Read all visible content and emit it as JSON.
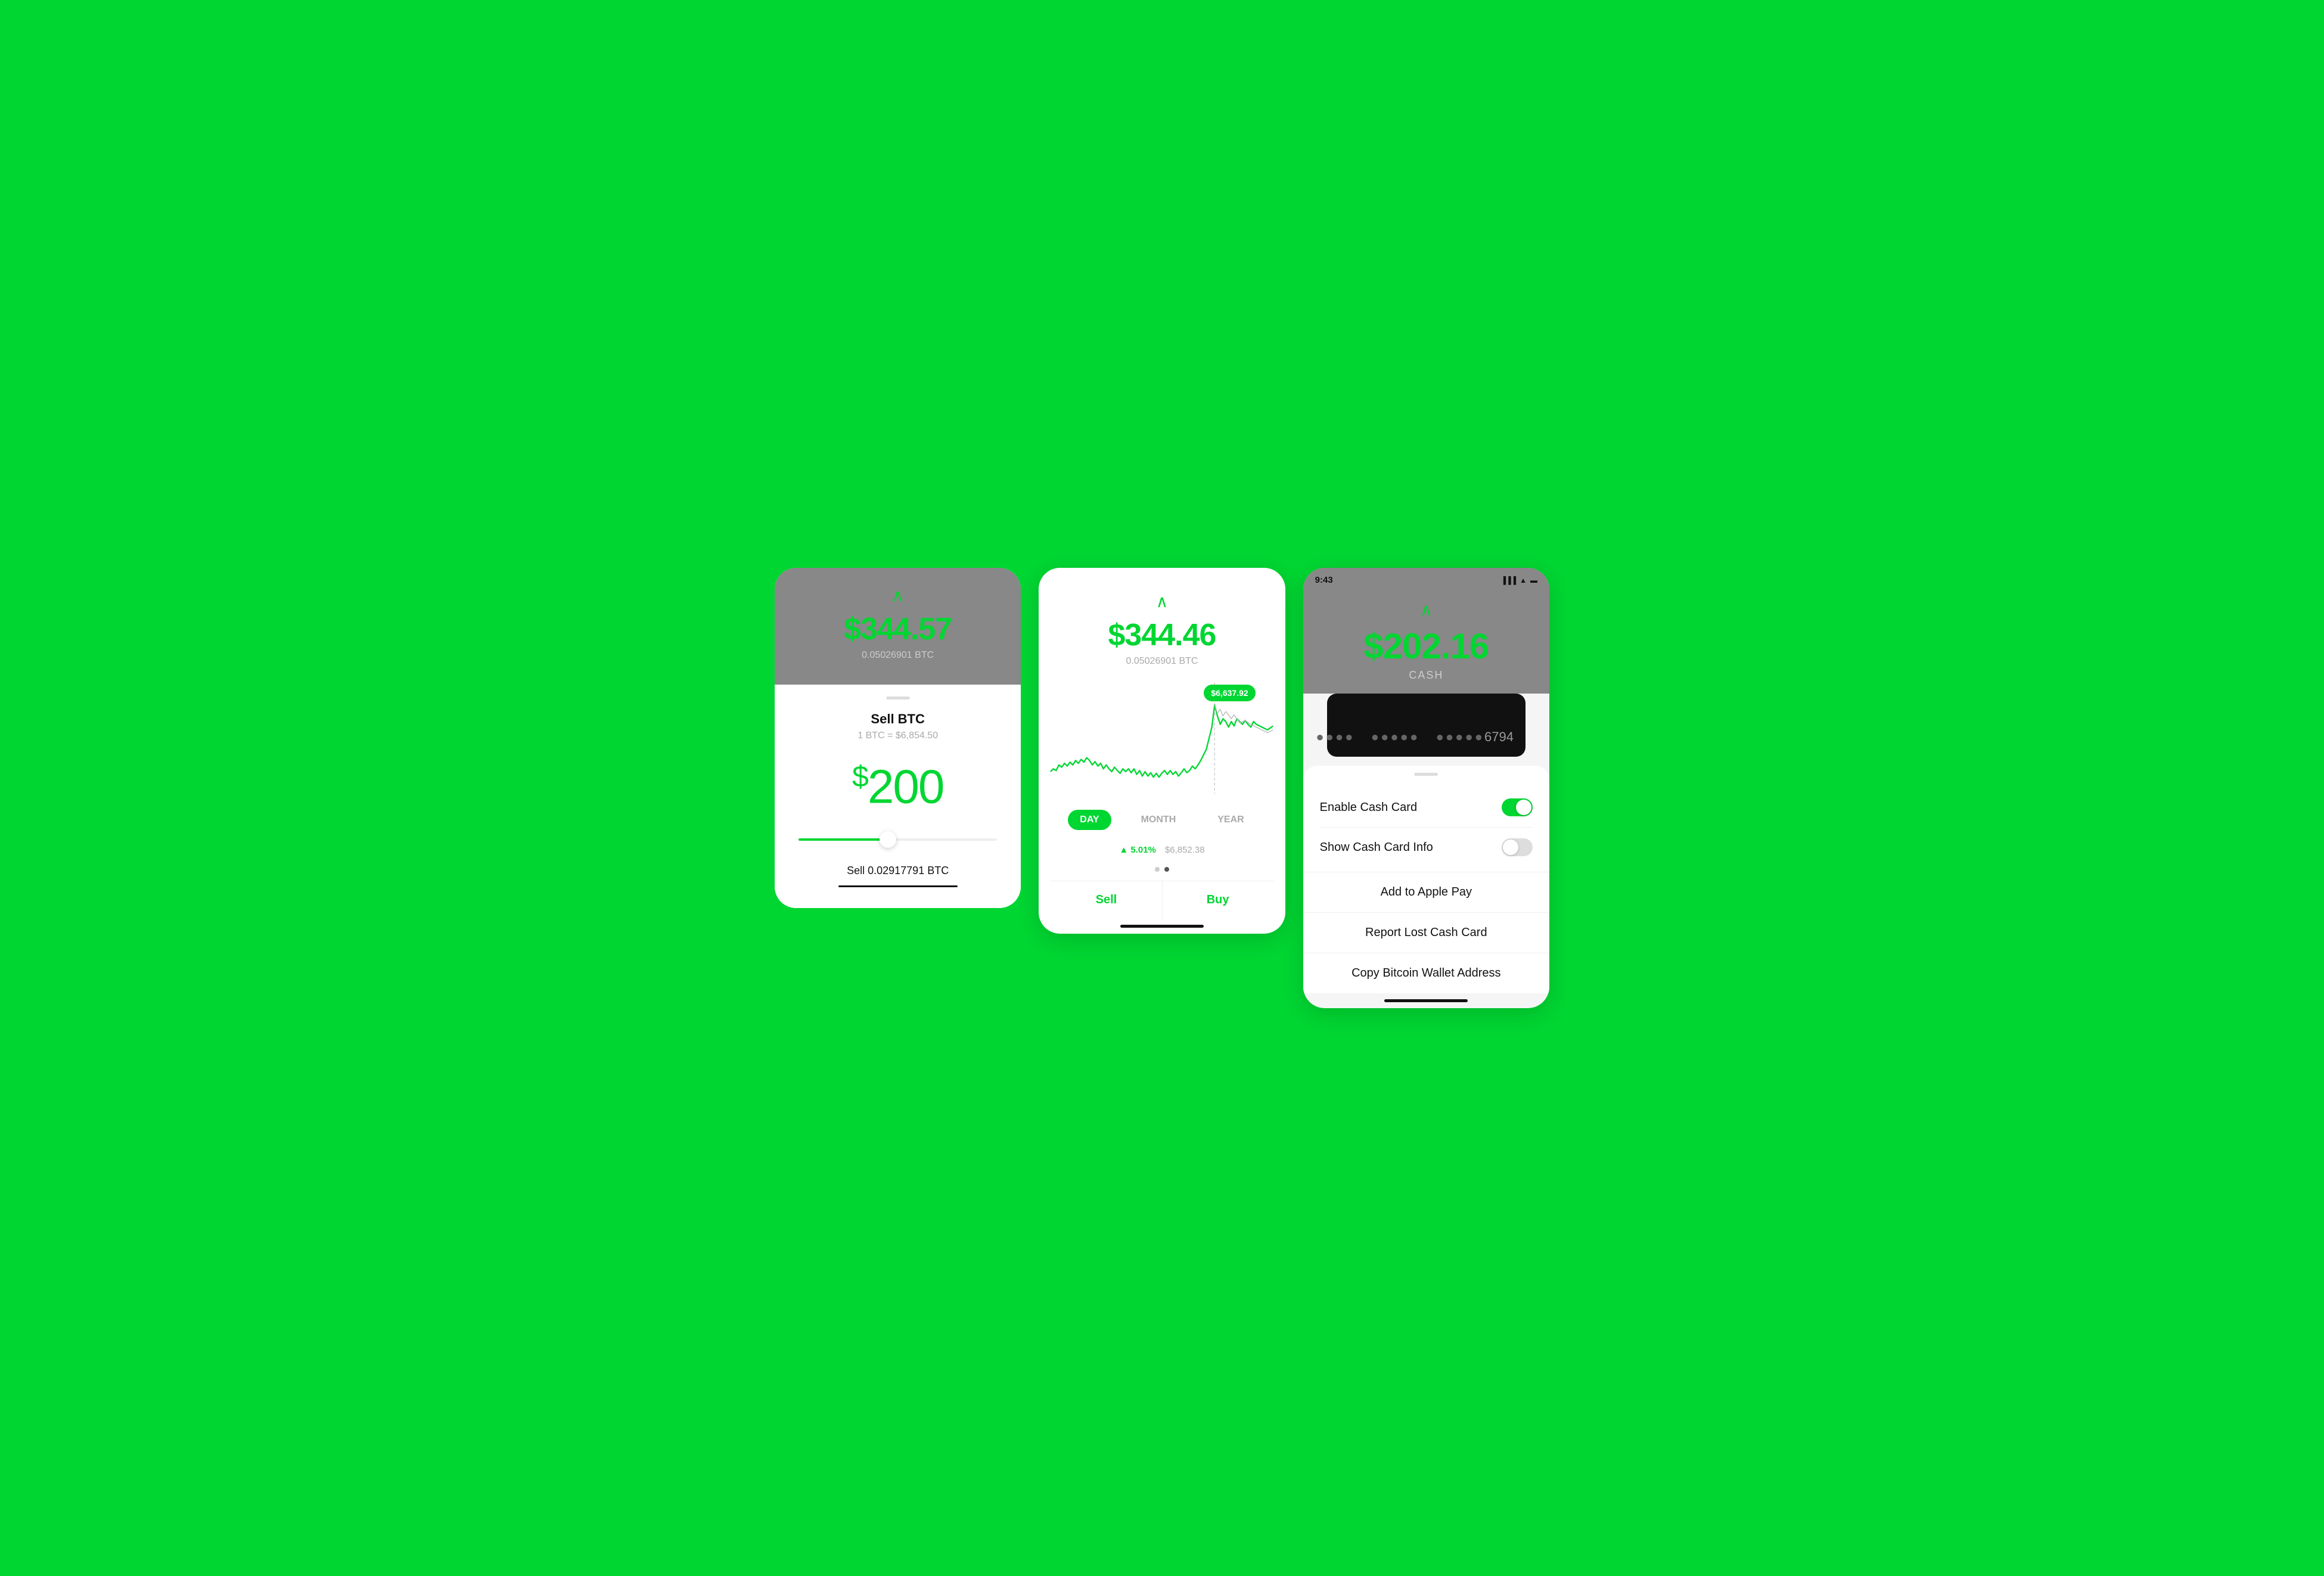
{
  "screen1": {
    "chevron": "∧",
    "btc_value": "$344.57",
    "btc_amount": "0.05026901 BTC",
    "handle": "",
    "title": "Sell BTC",
    "rate": "1 BTC = $6,854.50",
    "amount": "200",
    "slider_fill_width": "45%",
    "confirm_label": "Sell 0.02917791 BTC"
  },
  "screen2": {
    "chevron": "∧",
    "btc_value": "$344.46",
    "btc_amount": "0.05026901 BTC",
    "tooltip_price": "$6,637.92",
    "tabs": [
      {
        "label": "DAY",
        "active": true
      },
      {
        "label": "MONTH",
        "active": false
      },
      {
        "label": "YEAR",
        "active": false
      }
    ],
    "pct_change": "▲ 5.01%",
    "price_value": "$6,852.38",
    "sell_label": "Sell",
    "buy_label": "Buy"
  },
  "screen3": {
    "status_time": "9:43",
    "status_location": "◀",
    "signal": "▐▐▐",
    "wifi": "▲",
    "battery": "▬",
    "chevron": "∧",
    "cash_amount": "$202.16",
    "cash_label": "CASH",
    "card_dots": "●●●●    ●●●●●    ●●●●●",
    "card_last4": "6794",
    "enable_label": "Enable Cash Card",
    "show_info_label": "Show Cash Card Info",
    "apple_pay_label": "Add to Apple Pay",
    "report_lost_label": "Report Lost Cash Card",
    "copy_bitcoin_label": "Copy Bitcoin Wallet Address"
  }
}
